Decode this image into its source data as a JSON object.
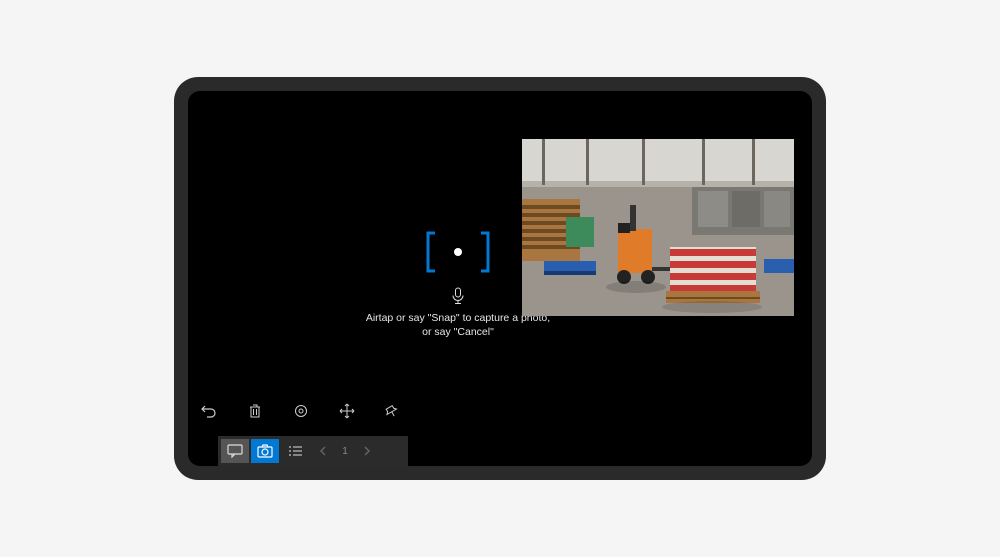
{
  "capture": {
    "instruction": "Airtap or say \"Snap\" to capture a photo,\nor say \"Cancel\"",
    "bracket_color": "#0078d4",
    "dot_color": "#ffffff"
  },
  "toolbar": {
    "items": [
      {
        "name": "undo-icon"
      },
      {
        "name": "delete-icon"
      },
      {
        "name": "settings-icon"
      },
      {
        "name": "move-icon"
      },
      {
        "name": "pin-icon"
      }
    ]
  },
  "bottom_bar": {
    "active_index": 1,
    "page": "1",
    "items": [
      {
        "name": "chat-icon"
      },
      {
        "name": "camera-icon"
      },
      {
        "name": "list-icon"
      }
    ]
  }
}
